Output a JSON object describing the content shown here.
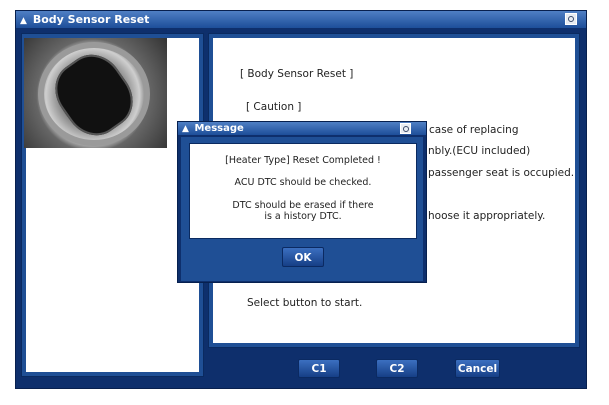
{
  "window": {
    "title": "Body Sensor Reset"
  },
  "instructions": {
    "heading": "[ Body Sensor Reset ]",
    "caution": "[ Caution ]",
    "line1": "case of replacing",
    "line2": "nbly.(ECU included)",
    "line3": "passenger seat is occupied.",
    "line4": "hoose it appropriately.",
    "prompt": "Select button to start."
  },
  "buttons": {
    "c1": "C1",
    "c2": "C2",
    "cancel": "Cancel"
  },
  "dialog": {
    "title": "Message",
    "line1": "[Heater Type] Reset Completed !",
    "line2": "ACU DTC should be checked.",
    "line3": "DTC should be erased if there",
    "line4": "is a history DTC.",
    "ok": "OK"
  }
}
